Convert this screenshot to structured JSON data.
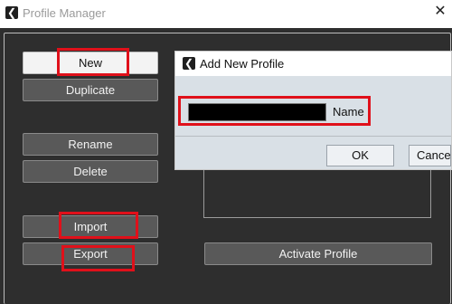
{
  "window": {
    "title": "Profile Manager",
    "close_glyph": "✕",
    "app_icon": "back-arrow-icon"
  },
  "buttons": {
    "new": "New",
    "duplicate": "Duplicate",
    "rename": "Rename",
    "delete": "Delete",
    "import": "Import",
    "export": "Export",
    "activate": "Activate Profile"
  },
  "dialog": {
    "title": "Add New Profile",
    "name_label": "Name",
    "name_value": "",
    "ok": "OK",
    "cancel": "Cancel"
  },
  "colors": {
    "highlight": "#e0101a",
    "panel": "#2e2e2e",
    "button": "#595959"
  }
}
